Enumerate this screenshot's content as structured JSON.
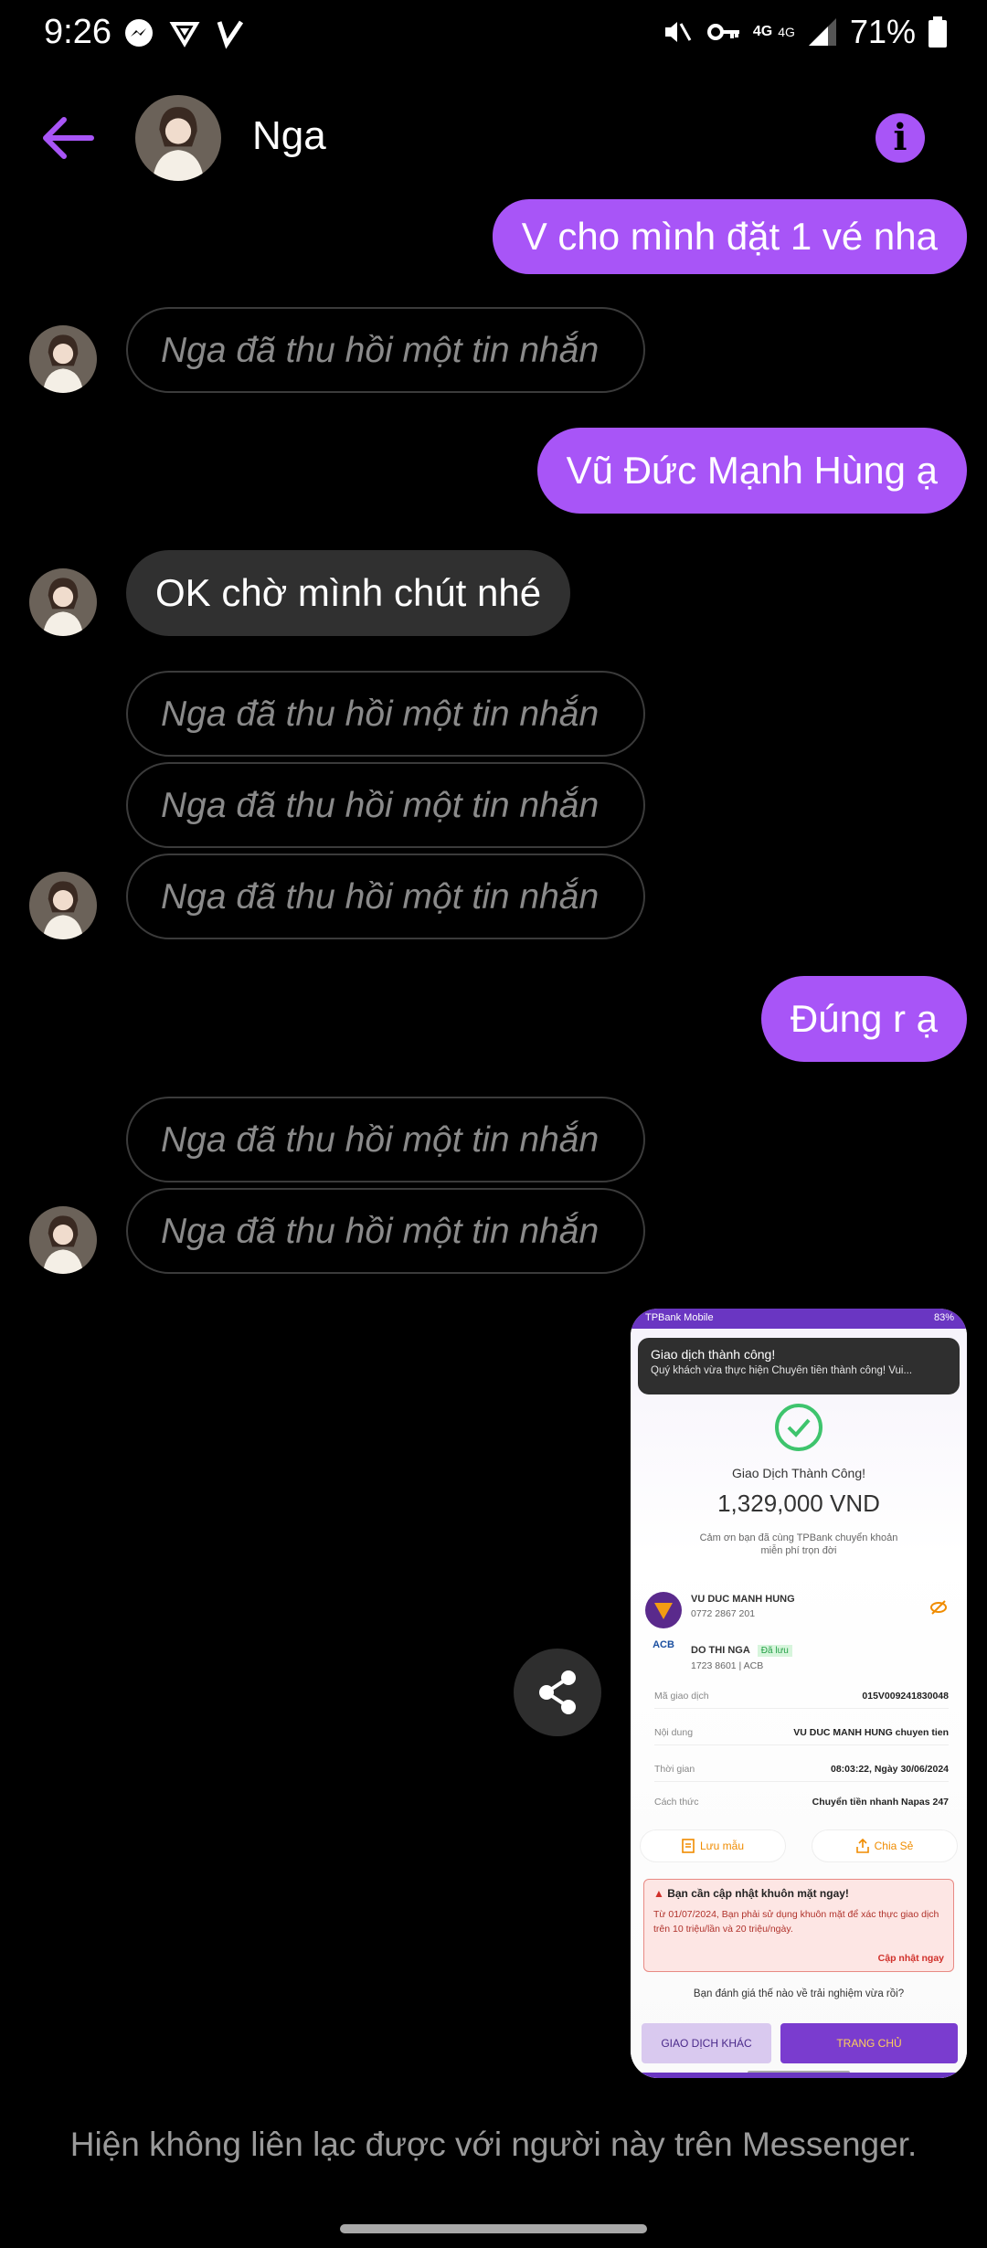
{
  "status_bar": {
    "time": "9:26",
    "battery": "71%",
    "net_label": "4G",
    "net_label2": "4G"
  },
  "header": {
    "contact_name": "Nga"
  },
  "messages": {
    "m1": "V cho mình đặt 1 vé nha",
    "recalled": "Nga đã thu hồi một tin nhắn",
    "m2": "Vũ Đức Mạnh Hùng ạ",
    "m3": "OK chờ mình chút nhé",
    "m4": "Đúng r ạ"
  },
  "screenshot": {
    "app_name": "TPBank Mobile",
    "battery": "83%",
    "toast_title": "Giao dịch thành công!",
    "toast_body": "Quý khách vừa thực hiện Chuyển tiền thành công! Vui...",
    "success_title": "Giao Dịch Thành Công!",
    "amount": "1,329,000 VND",
    "thanks_line1": "Cảm ơn bạn đã cùng TPBank chuyển khoản",
    "thanks_line2": "miễn phí trọn đời",
    "sender_name": "VU DUC MANH HUNG",
    "sender_account": "0772 2867 201",
    "receiver_name": "DO THI NGA",
    "receiver_saved": "Đã lưu",
    "receiver_account": "1723 8601  |  ACB",
    "bank_logo": "ACB",
    "rows": [
      {
        "label": "Mã giao dịch",
        "value": "015V009241830048"
      },
      {
        "label": "Nội dung",
        "value": "VU DUC MANH HUNG chuyen tien"
      },
      {
        "label": "Thời gian",
        "value": "08:03:22, Ngày 30/06/2024"
      },
      {
        "label": "Cách thức",
        "value": "Chuyển tiền nhanh Napas 247"
      }
    ],
    "save_template": "Lưu mẫu",
    "share": "Chia Sẻ",
    "warn_title": "Bạn cần cập nhật khuôn mặt ngay!",
    "warn_body": "Từ 01/07/2024, Bạn phải sử dụng khuôn mặt để xác thực giao dịch trên 10 triệu/lần và 20 triệu/ngày.",
    "warn_action": "Cập nhật ngay",
    "rating_question": "Bạn đánh giá thế nào về trải nghiệm vừa rồi?",
    "btn_other": "GIAO DỊCH KHÁC",
    "btn_home": "TRANG CHỦ"
  },
  "footer": {
    "note": "Hiện không liên lạc được với người này trên Messenger."
  },
  "icons": {
    "back": "arrow-left-icon",
    "info": "info-icon",
    "share": "share-icon"
  },
  "colors": {
    "accent": "#a855f7",
    "received_bubble": "#303030",
    "background": "#000000"
  }
}
